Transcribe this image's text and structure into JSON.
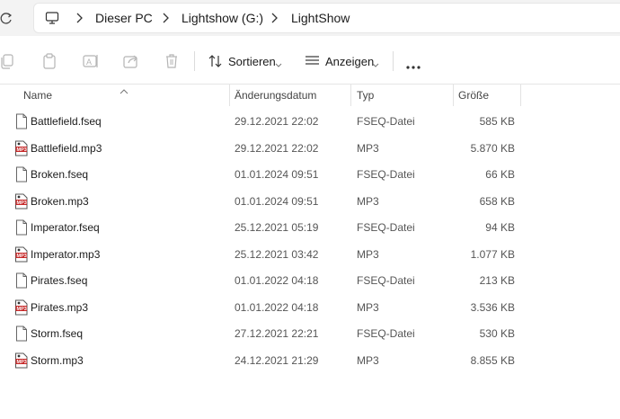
{
  "address": {
    "breadcrumbs": [
      "Dieser PC",
      "Lightshow (G:)",
      "LightShow"
    ]
  },
  "toolbar": {
    "icons": [
      "copy-icon",
      "paste-icon",
      "rename-icon",
      "share-icon",
      "delete-icon"
    ],
    "sort_label": "Sortieren",
    "view_label": "Anzeigen",
    "more_label": "..."
  },
  "columns": {
    "name": "Name",
    "modified": "Änderungsdatum",
    "type": "Typ",
    "size": "Größe"
  },
  "files": [
    {
      "name": "Battlefield.fseq",
      "date": "29.12.2021 22:02",
      "type": "FSEQ-Datei",
      "size": "585 KB",
      "icon": "fseq"
    },
    {
      "name": "Battlefield.mp3",
      "date": "29.12.2021 22:02",
      "type": "MP3",
      "size": "5.870 KB",
      "icon": "mp3"
    },
    {
      "name": "Broken.fseq",
      "date": "01.01.2024 09:51",
      "type": "FSEQ-Datei",
      "size": "66 KB",
      "icon": "fseq"
    },
    {
      "name": "Broken.mp3",
      "date": "01.01.2024 09:51",
      "type": "MP3",
      "size": "658 KB",
      "icon": "mp3"
    },
    {
      "name": "Imperator.fseq",
      "date": "25.12.2021 05:19",
      "type": "FSEQ-Datei",
      "size": "94 KB",
      "icon": "fseq"
    },
    {
      "name": "Imperator.mp3",
      "date": "25.12.2021 03:42",
      "type": "MP3",
      "size": "1.077 KB",
      "icon": "mp3"
    },
    {
      "name": "Pirates.fseq",
      "date": "01.01.2022 04:18",
      "type": "FSEQ-Datei",
      "size": "213 KB",
      "icon": "fseq"
    },
    {
      "name": "Pirates.mp3",
      "date": "01.01.2022 04:18",
      "type": "MP3",
      "size": "3.536 KB",
      "icon": "mp3"
    },
    {
      "name": "Storm.fseq",
      "date": "27.12.2021 22:21",
      "type": "FSEQ-Datei",
      "size": "530 KB",
      "icon": "fseq"
    },
    {
      "name": "Storm.mp3",
      "date": "24.12.2021 21:29",
      "type": "MP3",
      "size": "8.855 KB",
      "icon": "mp3"
    }
  ]
}
